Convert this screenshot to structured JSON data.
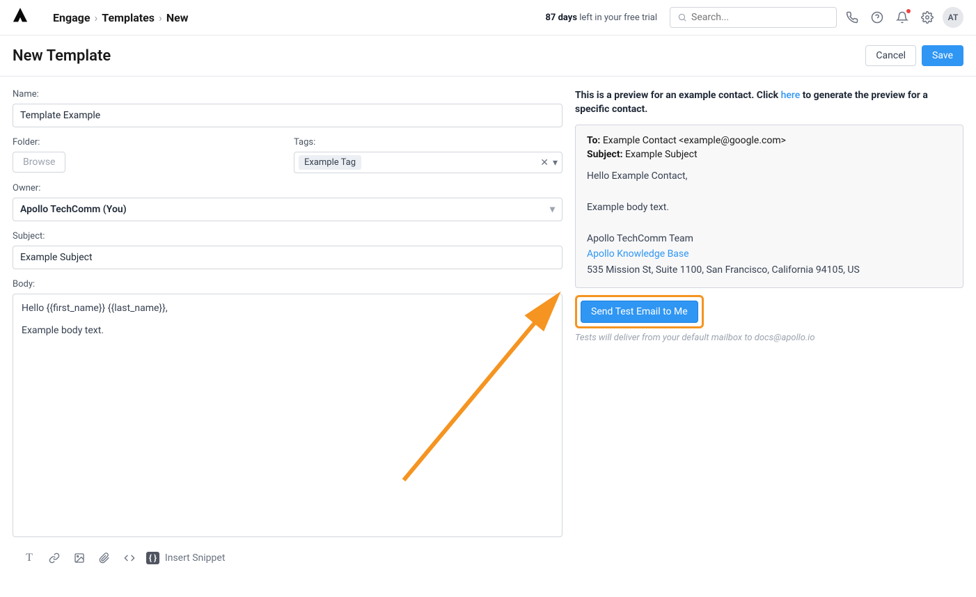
{
  "breadcrumb": {
    "item1": "Engage",
    "item2": "Templates",
    "item3": "New"
  },
  "trial": {
    "days": "87 days",
    "text": " left in your free trial"
  },
  "search": {
    "placeholder": "Search..."
  },
  "avatar": {
    "initials": "AT"
  },
  "page": {
    "title": "New Template",
    "cancel": "Cancel",
    "save": "Save"
  },
  "form": {
    "name_label": "Name:",
    "name_value": "Template Example",
    "folder_label": "Folder:",
    "browse": "Browse",
    "tags_label": "Tags:",
    "tag_value": "Example Tag",
    "owner_label": "Owner:",
    "owner_value": "Apollo TechComm (You)",
    "subject_label": "Subject:",
    "subject_value": "Example Subject",
    "body_label": "Body:",
    "body_value": "Hello {{first_name}} {{last_name}},\n\nExample body text."
  },
  "toolbar": {
    "insert_snippet": "Insert Snippet"
  },
  "preview": {
    "notice_part1": "This is a preview for an example contact. Click ",
    "notice_link": "here",
    "notice_part2": " to generate the preview for a specific contact.",
    "to_label": "To:",
    "to_value": " Example Contact <example@google.com>",
    "subject_label": "Subject:",
    "subject_value": " Example Subject",
    "greeting": "Hello Example Contact,",
    "body_text": "Example body text.",
    "signature_team": "Apollo TechComm Team",
    "signature_link": "Apollo Knowledge Base",
    "address": "535 Mission St, Suite 1100, San Francisco, California 94105, US",
    "send_test": "Send Test Email to Me",
    "test_note": "Tests will deliver from your default mailbox to docs@apollo.io"
  }
}
